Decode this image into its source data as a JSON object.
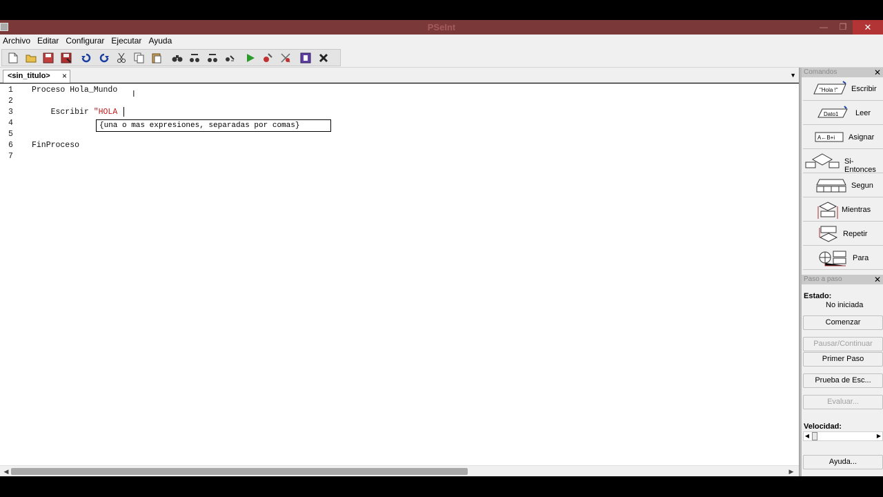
{
  "window": {
    "title": "PSeInt",
    "close_label": "✕",
    "min_label": "—",
    "max_label": "❐"
  },
  "menu": [
    "Archivo",
    "Editar",
    "Configurar",
    "Ejecutar",
    "Ayuda"
  ],
  "toolbar": {
    "icons": [
      "new-file-icon",
      "open-folder-icon",
      "save-icon",
      "save-as-icon",
      "undo-icon",
      "redo-icon",
      "cut-icon",
      "copy-icon",
      "paste-icon",
      "find-icon",
      "find-prev-icon",
      "find-next-icon",
      "replace-icon",
      "run-icon",
      "step-run-icon",
      "debug-icon",
      "flowchart-icon",
      "close-icon"
    ]
  },
  "tabs": [
    {
      "label": "<sin_titulo>",
      "close": "×"
    }
  ],
  "editor": {
    "lines": [
      {
        "num": "1",
        "text": "Proceso Hola_Mundo"
      },
      {
        "num": "2",
        "text": ""
      },
      {
        "num": "3",
        "text_kw": "    Escribir ",
        "text_str": "\"HOLA "
      },
      {
        "num": "4",
        "text": ""
      },
      {
        "num": "5",
        "text": ""
      },
      {
        "num": "6",
        "text": "FinProceso"
      },
      {
        "num": "7",
        "text": ""
      }
    ],
    "tooltip": "{una o mas expresiones, separadas por comas}"
  },
  "commands_panel": {
    "title": "Comandos",
    "items": [
      {
        "label": "Escribir",
        "glyph_text": "\"Hola !\""
      },
      {
        "label": "Leer",
        "glyph_text": "Dato1"
      },
      {
        "label": "Asignar",
        "glyph_text": "A←B+i"
      },
      {
        "label": "Si-Entonces",
        "glyph_text": ""
      },
      {
        "label": "Segun",
        "glyph_text": ""
      },
      {
        "label": "Mientras",
        "glyph_text": ""
      },
      {
        "label": "Repetir",
        "glyph_text": ""
      },
      {
        "label": "Para",
        "glyph_text": ""
      }
    ]
  },
  "step_panel": {
    "title": "Paso a paso",
    "estado_label": "Estado:",
    "estado_value": "No iniciada",
    "comenzar": "Comenzar",
    "pausar": "Pausar/Continuar",
    "primer_paso": "Primer Paso",
    "prueba": "Prueba de Esc...",
    "evaluar": "Evaluar...",
    "velocidad_label": "Velocidad:",
    "ayuda": "Ayuda..."
  },
  "colors": {
    "titlebar": "#7a3838",
    "close_button": "#b33434",
    "string": "#c01818"
  }
}
